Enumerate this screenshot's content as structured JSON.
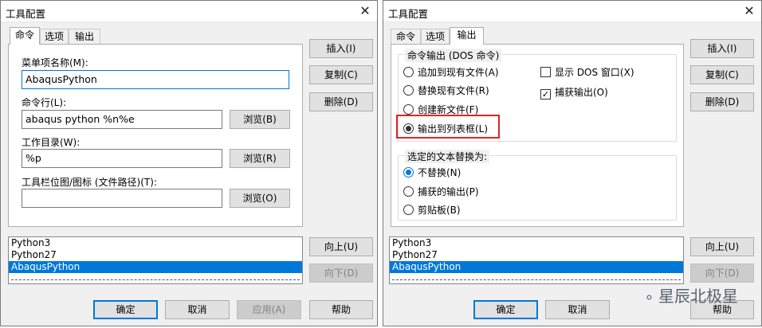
{
  "left": {
    "title": "工具配置",
    "close": "✕",
    "tabs": [
      "命令",
      "选项",
      "输出"
    ],
    "menu_label": "菜单项名称(M):",
    "menu_value": "AbaqusPython",
    "cmd_label": "命令行(L):",
    "cmd_value": "abaqus python %n%e",
    "dir_label": "工作目录(W):",
    "dir_value": "%p",
    "icon_label": "工具栏位图/图标 (文件路径)(T):",
    "icon_value": "",
    "browse_b": "浏览(B)",
    "browse_r": "浏览(R)",
    "browse_o": "浏览(O)",
    "insert": "插入(I)",
    "copy": "复制(C)",
    "delete": "删除(D)",
    "list": [
      "Python3",
      "Python27",
      "AbaqusPython"
    ],
    "up": "向上(U)",
    "down": "向下(D)",
    "ok": "确定",
    "cancel": "取消",
    "apply": "应用(A)",
    "help": "帮助"
  },
  "right": {
    "title": "工具配置",
    "close": "✕",
    "tabs": [
      "命令",
      "选项",
      "输出"
    ],
    "out_group": "命令输出 (DOS 命令)",
    "r_append": "追加到现有文件(A)",
    "r_replace": "替换现有文件(R)",
    "r_new": "创建新文件(F)",
    "r_list": "输出到列表框(L)",
    "show_dos": "显示 DOS 窗口(X)",
    "capture": "捕获输出(O)",
    "sub_group": "选定的文本替换为:",
    "s_none": "不替换(N)",
    "s_capture": "捕获的输出(P)",
    "s_clip": "剪贴板(B)",
    "insert": "插入(I)",
    "copy": "复制(C)",
    "delete": "删除(D)",
    "list": [
      "Python3",
      "Python27",
      "AbaqusPython"
    ],
    "up": "向上(U)",
    "down": "向下(D)",
    "ok": "确定",
    "cancel": "取消",
    "help": "帮助"
  },
  "watermark": "星辰北极星",
  "colors": {
    "accent": "#0078d7",
    "highlight": "#e02424"
  }
}
